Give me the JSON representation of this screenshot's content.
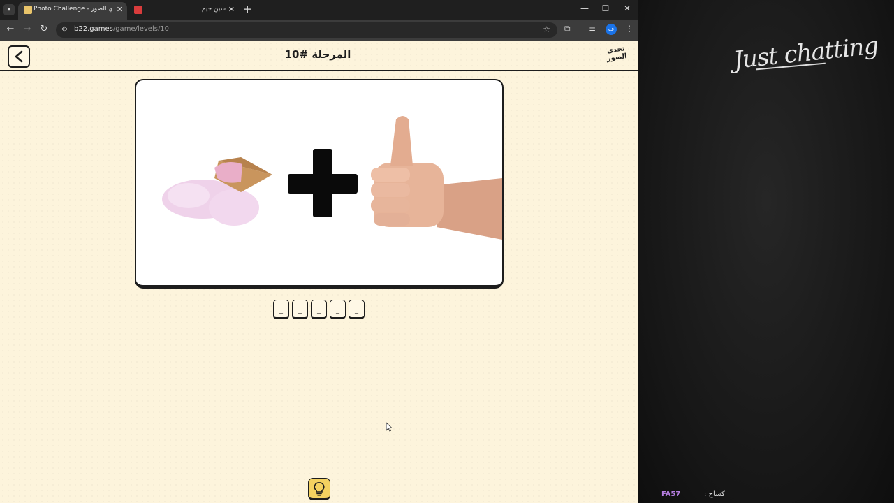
{
  "browser": {
    "tabs": [
      {
        "title": "Photo Challenge - تحدي الصور",
        "active": true
      },
      {
        "title": "سين جيم",
        "active": false
      }
    ],
    "url_domain": "b22.games",
    "url_path": "/game/levels/10",
    "profile_initial": "ف"
  },
  "game": {
    "level_title": "المرحلة #10",
    "logo_text": "تحدي الصور",
    "answer_slots": [
      "_",
      "_",
      "_",
      "_",
      "_"
    ]
  },
  "stream_panel": {
    "title": "Just chatting",
    "footer_code": "FA57",
    "footer_label": ": كساح"
  },
  "colors": {
    "page_bg": "#fdf4dc",
    "accent": "#1d1d1d",
    "hint_button": "#f3d160",
    "footer_code": "#b57ee0"
  },
  "icons": {
    "back": "chevron-left-icon",
    "hint": "lightbulb-icon",
    "bookmark": "star-icon",
    "extensions": "puzzle-icon"
  }
}
